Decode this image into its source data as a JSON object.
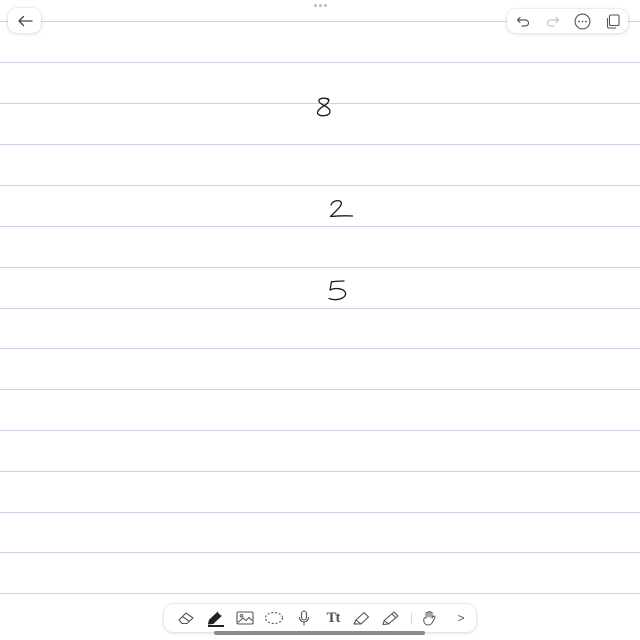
{
  "top_bar": {
    "back_icon": "arrow-left-icon",
    "undo_icon": "undo-icon",
    "redo_icon": "redo-icon",
    "more_icon": "ellipsis-circle-icon",
    "pages_icon": "pages-copy-icon"
  },
  "canvas": {
    "handwritten_digits": [
      "8",
      "2",
      "5"
    ],
    "ink_color": "#1a1a1a",
    "rule_color": "#c9d3e3"
  },
  "toolbar": {
    "tools": [
      {
        "icon": "eraser-icon",
        "active": false
      },
      {
        "icon": "pen-icon",
        "active": true
      },
      {
        "icon": "image-icon",
        "active": false
      },
      {
        "icon": "lasso-icon",
        "active": false
      },
      {
        "icon": "microphone-icon",
        "active": false
      },
      {
        "icon": "text-icon",
        "active": false
      },
      {
        "icon": "highlighter-icon",
        "active": false
      },
      {
        "icon": "pencil-icon",
        "active": false
      },
      {
        "icon": "hand-draw-icon",
        "active": false
      },
      {
        "icon": "chevron-right-icon",
        "active": false
      }
    ],
    "text_tool_label": "Tt",
    "more_label": ">"
  }
}
